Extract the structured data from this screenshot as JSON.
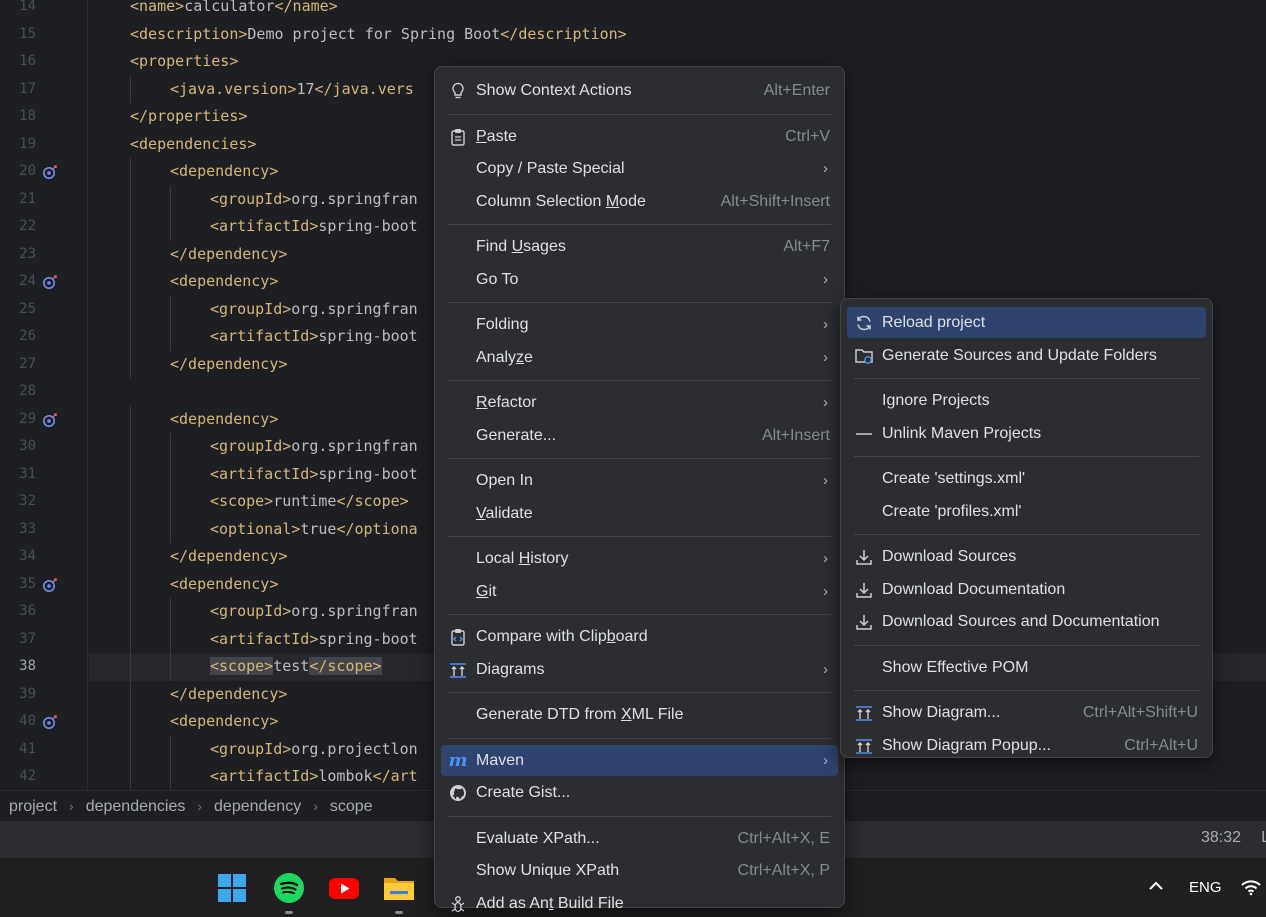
{
  "editor": {
    "lines": [
      {
        "num": "14",
        "indent": 1,
        "code": [
          [
            "tg",
            "<name>"
          ],
          [
            "tx",
            "calculator"
          ],
          [
            "tg",
            "</name>"
          ]
        ]
      },
      {
        "num": "15",
        "indent": 1,
        "code": [
          [
            "tg",
            "<description>"
          ],
          [
            "tx",
            "Demo project for Spring Boot"
          ],
          [
            "tg",
            "</description>"
          ]
        ]
      },
      {
        "num": "16",
        "indent": 1,
        "code": [
          [
            "tg",
            "<properties>"
          ]
        ]
      },
      {
        "num": "17",
        "indent": 2,
        "code": [
          [
            "tg",
            "<java.version>"
          ],
          [
            "tx",
            "17"
          ],
          [
            "tg",
            "</java.vers"
          ]
        ]
      },
      {
        "num": "18",
        "indent": 1,
        "code": [
          [
            "tg",
            "</properties>"
          ]
        ]
      },
      {
        "num": "19",
        "indent": 1,
        "code": [
          [
            "tg",
            "<dependencies>"
          ]
        ]
      },
      {
        "num": "20",
        "indent": 2,
        "mark": true,
        "code": [
          [
            "tg",
            "<dependency>"
          ]
        ]
      },
      {
        "num": "21",
        "indent": 3,
        "code": [
          [
            "tg",
            "<groupId>"
          ],
          [
            "tx",
            "org.springfran"
          ]
        ]
      },
      {
        "num": "22",
        "indent": 3,
        "code": [
          [
            "tg",
            "<artifactId>"
          ],
          [
            "tx",
            "spring-boot"
          ]
        ]
      },
      {
        "num": "23",
        "indent": 2,
        "code": [
          [
            "tg",
            "</dependency>"
          ]
        ]
      },
      {
        "num": "24",
        "indent": 2,
        "mark": true,
        "code": [
          [
            "tg",
            "<dependency>"
          ]
        ]
      },
      {
        "num": "25",
        "indent": 3,
        "code": [
          [
            "tg",
            "<groupId>"
          ],
          [
            "tx",
            "org.springfran"
          ]
        ]
      },
      {
        "num": "26",
        "indent": 3,
        "code": [
          [
            "tg",
            "<artifactId>"
          ],
          [
            "tx",
            "spring-boot"
          ]
        ]
      },
      {
        "num": "27",
        "indent": 2,
        "code": [
          [
            "tg",
            "</dependency>"
          ]
        ]
      },
      {
        "num": "28",
        "indent": 0,
        "code": []
      },
      {
        "num": "29",
        "indent": 2,
        "mark": true,
        "code": [
          [
            "tg",
            "<dependency>"
          ]
        ]
      },
      {
        "num": "30",
        "indent": 3,
        "code": [
          [
            "tg",
            "<groupId>"
          ],
          [
            "tx",
            "org.springfran"
          ]
        ]
      },
      {
        "num": "31",
        "indent": 3,
        "code": [
          [
            "tg",
            "<artifactId>"
          ],
          [
            "tx",
            "spring-boot"
          ]
        ]
      },
      {
        "num": "32",
        "indent": 3,
        "code": [
          [
            "tg",
            "<scope>"
          ],
          [
            "tx",
            "runtime"
          ],
          [
            "tg",
            "</scope>"
          ]
        ]
      },
      {
        "num": "33",
        "indent": 3,
        "code": [
          [
            "tg",
            "<optional>"
          ],
          [
            "tx",
            "true"
          ],
          [
            "tg",
            "</optiona"
          ]
        ]
      },
      {
        "num": "34",
        "indent": 2,
        "code": [
          [
            "tg",
            "</dependency>"
          ]
        ]
      },
      {
        "num": "35",
        "indent": 2,
        "mark": true,
        "code": [
          [
            "tg",
            "<dependency>"
          ]
        ]
      },
      {
        "num": "36",
        "indent": 3,
        "code": [
          [
            "tg",
            "<groupId>"
          ],
          [
            "tx",
            "org.springfran"
          ]
        ]
      },
      {
        "num": "37",
        "indent": 3,
        "code": [
          [
            "tg",
            "<artifactId>"
          ],
          [
            "tx",
            "spring-boot"
          ]
        ]
      },
      {
        "num": "38",
        "indent": 3,
        "current": true,
        "code": [
          [
            "tg hl",
            "<scope>"
          ],
          [
            "tx",
            "test"
          ],
          [
            "tg hl",
            "</scope>"
          ]
        ]
      },
      {
        "num": "39",
        "indent": 2,
        "code": [
          [
            "tg",
            "</dependency>"
          ]
        ]
      },
      {
        "num": "40",
        "indent": 2,
        "mark": true,
        "code": [
          [
            "tg",
            "<dependency>"
          ]
        ]
      },
      {
        "num": "41",
        "indent": 3,
        "code": [
          [
            "tg",
            "<groupId>"
          ],
          [
            "tx",
            "org.projectlon"
          ]
        ]
      },
      {
        "num": "42",
        "indent": 3,
        "code": [
          [
            "tg",
            "<artifactId>"
          ],
          [
            "tx",
            "lombok"
          ],
          [
            "tg",
            "</art"
          ]
        ]
      }
    ]
  },
  "breadcrumbs": [
    "project",
    "dependencies",
    "dependency",
    "scope"
  ],
  "status": {
    "caret": "38:32",
    "extra": "L"
  },
  "taskbar": {
    "language": "ENG"
  },
  "context_menu": {
    "items": [
      {
        "type": "item",
        "label": "Show Context Actions",
        "shortcut": "Alt+Enter",
        "icon": "lightbulb-icon"
      },
      {
        "type": "sep"
      },
      {
        "type": "item",
        "label": "Paste",
        "mn": 0,
        "shortcut": "Ctrl+V",
        "icon": "clipboard-icon"
      },
      {
        "type": "item",
        "label": "Copy / Paste Special",
        "submenu": true
      },
      {
        "type": "item",
        "label": "Column Selection Mode",
        "mn": 17,
        "shortcut": "Alt+Shift+Insert"
      },
      {
        "type": "sep"
      },
      {
        "type": "item",
        "label": "Find Usages",
        "mn": 5,
        "shortcut": "Alt+F7"
      },
      {
        "type": "item",
        "label": "Go To",
        "submenu": true
      },
      {
        "type": "sep"
      },
      {
        "type": "item",
        "label": "Folding",
        "submenu": true
      },
      {
        "type": "item",
        "label": "Analyze",
        "mn": 5,
        "submenu": true
      },
      {
        "type": "sep"
      },
      {
        "type": "item",
        "label": "Refactor",
        "mn": 0,
        "submenu": true
      },
      {
        "type": "item",
        "label": "Generate...",
        "shortcut": "Alt+Insert"
      },
      {
        "type": "sep"
      },
      {
        "type": "item",
        "label": "Open In",
        "submenu": true
      },
      {
        "type": "item",
        "label": "Validate",
        "mn": 0
      },
      {
        "type": "sep"
      },
      {
        "type": "item",
        "label": "Local History",
        "mn": 6,
        "submenu": true
      },
      {
        "type": "item",
        "label": "Git",
        "mn": 0,
        "submenu": true
      },
      {
        "type": "sep"
      },
      {
        "type": "item",
        "label": "Compare with Clipboard",
        "mn": 17,
        "icon": "compare-clipboard-icon"
      },
      {
        "type": "item",
        "label": "Diagrams",
        "submenu": true,
        "icon": "diagram-icon"
      },
      {
        "type": "sep"
      },
      {
        "type": "item",
        "label": "Generate DTD from XML File",
        "mn": 18
      },
      {
        "type": "sep"
      },
      {
        "type": "item",
        "label": "Maven",
        "submenu": true,
        "selected": true,
        "icon": "maven-icon"
      },
      {
        "type": "item",
        "label": "Create Gist...",
        "icon": "github-icon"
      },
      {
        "type": "sep"
      },
      {
        "type": "item",
        "label": "Evaluate XPath...",
        "shortcut": "Ctrl+Alt+X, E"
      },
      {
        "type": "item",
        "label": "Show Unique XPath",
        "shortcut": "Ctrl+Alt+X, P"
      },
      {
        "type": "item",
        "label": "Add as Ant Build File",
        "mn": 9,
        "icon": "ant-icon"
      }
    ]
  },
  "maven_menu": {
    "items": [
      {
        "type": "item",
        "label": "Reload project",
        "selected": true,
        "icon": "reload-icon"
      },
      {
        "type": "item",
        "label": "Generate Sources and Update Folders",
        "icon": "folder-refresh-icon"
      },
      {
        "type": "sep"
      },
      {
        "type": "item",
        "label": "Ignore Projects"
      },
      {
        "type": "item",
        "label": "Unlink Maven Projects",
        "icon": "dash-icon"
      },
      {
        "type": "sep"
      },
      {
        "type": "item",
        "label": "Create 'settings.xml'"
      },
      {
        "type": "item",
        "label": "Create 'profiles.xml'"
      },
      {
        "type": "sep"
      },
      {
        "type": "item",
        "label": "Download Sources",
        "icon": "download-icon"
      },
      {
        "type": "item",
        "label": "Download Documentation",
        "icon": "download-icon"
      },
      {
        "type": "item",
        "label": "Download Sources and Documentation",
        "icon": "download-icon"
      },
      {
        "type": "sep"
      },
      {
        "type": "item",
        "label": "Show Effective POM"
      },
      {
        "type": "sep"
      },
      {
        "type": "item",
        "label": "Show Diagram...",
        "shortcut": "Ctrl+Alt+Shift+U",
        "icon": "diagram-icon"
      },
      {
        "type": "item",
        "label": "Show Diagram Popup...",
        "shortcut": "Ctrl+Alt+U",
        "icon": "diagram-icon"
      }
    ]
  },
  "colors": {
    "selection": "#2e436e",
    "tag": "#d5b778",
    "menu_bg": "#2b2d30",
    "maven_accent": "#4f8ff7"
  }
}
